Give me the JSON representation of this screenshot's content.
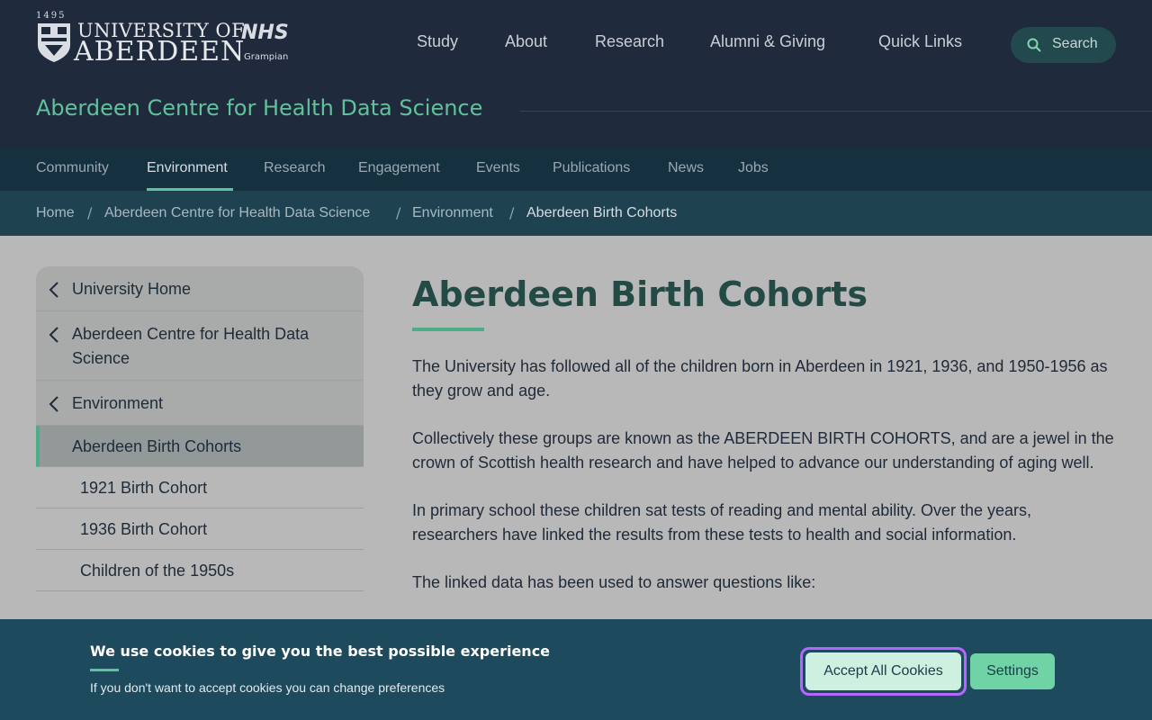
{
  "logo": {
    "year": "1495",
    "line1": "UNIVERSITY OF",
    "line2": "ABERDEEN",
    "partner": "NHS",
    "partner_sub": "Grampian"
  },
  "main_nav": [
    "Study",
    "About",
    "Research",
    "Alumni & Giving",
    "Quick Links"
  ],
  "search": {
    "label": "Search",
    "icon": "search-icon"
  },
  "centre_title": "Aberdeen Centre for Health Data Science",
  "sub_nav": {
    "items": [
      "Community",
      "Environment",
      "Research",
      "Engagement",
      "Events",
      "Publications",
      "News",
      "Jobs"
    ],
    "active": "Environment"
  },
  "breadcrumb": [
    "Home",
    "Aberdeen Centre for Health Data Science",
    "Environment",
    "Aberdeen Birth Cohorts"
  ],
  "breadcrumb_separator": "/",
  "side_nav": {
    "back_links": [
      "University Home",
      "Aberdeen Centre for Health Data Science",
      "Environment"
    ],
    "current": "Aberdeen Birth Cohorts",
    "children": [
      "1921 Birth Cohort",
      "1936 Birth Cohort",
      "Children of the 1950s"
    ]
  },
  "article": {
    "title": "Aberdeen Birth Cohorts",
    "paragraphs": [
      "The University has followed all of the children born in Aberdeen in 1921, 1936, and 1950-1956 as they grow and age.",
      "Collectively these groups are known as the ABERDEEN BIRTH COHORTS, and are a jewel in the crown of Scottish health research and have helped to advance our understanding of aging well.",
      "In primary school these children sat tests of reading and mental ability. Over the years, researchers have linked the results from these tests to health and social information.",
      "The linked data has been used to answer questions like:"
    ]
  },
  "cookie_banner": {
    "title": "We use cookies to give you the best possible experience",
    "subtitle": "If you don't want to accept cookies you can change preferences",
    "accept_label": "Accept All Cookies",
    "settings_label": "Settings"
  },
  "colors": {
    "header_bg": "#1f2a3c",
    "accent_green": "#5fc29a",
    "cookie_bg": "#1d4a5c",
    "focus_ring": "#b466ff"
  }
}
